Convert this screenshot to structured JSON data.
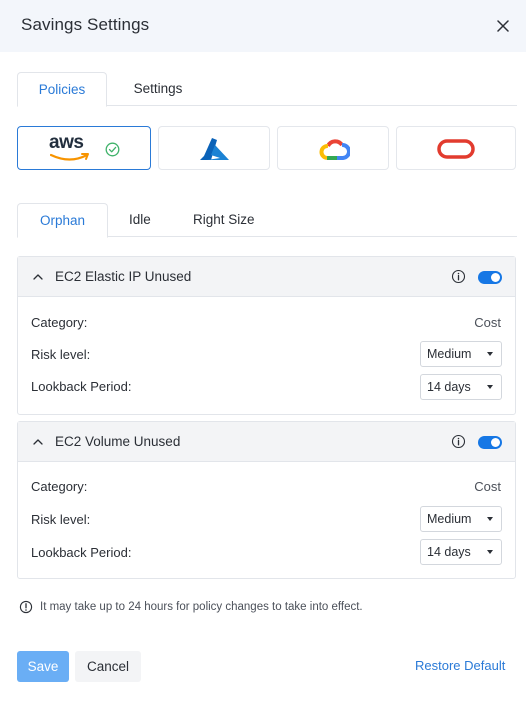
{
  "dialog": {
    "title": "Savings Settings"
  },
  "main_tabs": [
    {
      "label": "Policies",
      "active": true
    },
    {
      "label": "Settings",
      "active": false
    }
  ],
  "providers": [
    {
      "icon": "aws-logo-icon",
      "selected": true,
      "logo_text": "aws"
    },
    {
      "icon": "azure-logo-icon",
      "selected": false
    },
    {
      "icon": "google-cloud-logo-icon",
      "selected": false
    },
    {
      "icon": "oracle-logo-icon",
      "selected": false
    }
  ],
  "sub_tabs": [
    {
      "label": "Orphan",
      "active": true
    },
    {
      "label": "Idle",
      "active": false
    },
    {
      "label": "Right Size",
      "active": false
    }
  ],
  "policies": [
    {
      "title": "EC2 Elastic IP Unused",
      "enabled": true,
      "category_label": "Category:",
      "category_value": "Cost",
      "risk_label": "Risk level:",
      "risk_value": "Medium",
      "lookback_label": "Lookback Period:",
      "lookback_value": "14 days"
    },
    {
      "title": "EC2 Volume Unused",
      "enabled": true,
      "category_label": "Category:",
      "category_value": "Cost",
      "risk_label": "Risk level:",
      "risk_value": "Medium",
      "lookback_label": "Lookback Period:",
      "lookback_value": "14 days"
    }
  ],
  "notice": "It may take up to 24 hours for policy changes to take into effect.",
  "footer": {
    "save_label": "Save",
    "cancel_label": "Cancel",
    "restore_label": "Restore Default"
  },
  "colors": {
    "accent": "#2a7ad7",
    "toggle_on": "#1677e5",
    "save_disabled": "#6aaef5",
    "header_bg": "#f3f6fb"
  }
}
